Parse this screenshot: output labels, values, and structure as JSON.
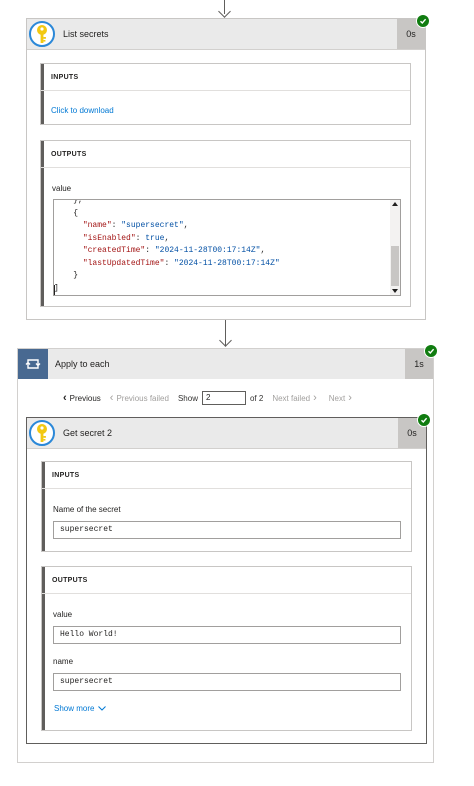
{
  "list_secrets": {
    "title": "List secrets",
    "duration": "0s",
    "inputs": {
      "heading": "INPUTS",
      "download_link": "Click to download"
    },
    "outputs": {
      "heading": "OUTPUTS",
      "value_label": "value",
      "json_lines": [
        {
          "indent": "    ",
          "parts": [
            {
              "t": "p",
              "v": "},"
            }
          ]
        },
        {
          "indent": "    ",
          "parts": [
            {
              "t": "p",
              "v": "{"
            }
          ]
        },
        {
          "indent": "      ",
          "parts": [
            {
              "t": "k",
              "v": "\"name\""
            },
            {
              "t": "p",
              "v": ": "
            },
            {
              "t": "s",
              "v": "\"supersecret\""
            },
            {
              "t": "p",
              "v": ","
            }
          ]
        },
        {
          "indent": "      ",
          "parts": [
            {
              "t": "k",
              "v": "\"isEnabled\""
            },
            {
              "t": "p",
              "v": ": "
            },
            {
              "t": "s",
              "v": "true"
            },
            {
              "t": "p",
              "v": ","
            }
          ]
        },
        {
          "indent": "      ",
          "parts": [
            {
              "t": "k",
              "v": "\"createdTime\""
            },
            {
              "t": "p",
              "v": ": "
            },
            {
              "t": "s",
              "v": "\"2024-11-28T00:17:14Z\""
            },
            {
              "t": "p",
              "v": ","
            }
          ]
        },
        {
          "indent": "      ",
          "parts": [
            {
              "t": "k",
              "v": "\"lastUpdatedTime\""
            },
            {
              "t": "p",
              "v": ": "
            },
            {
              "t": "s",
              "v": "\"2024-11-28T00:17:14Z\""
            }
          ]
        },
        {
          "indent": "    ",
          "parts": [
            {
              "t": "p",
              "v": "}"
            }
          ]
        },
        {
          "indent": "",
          "parts": [
            {
              "t": "p",
              "v": "]"
            }
          ]
        }
      ]
    }
  },
  "apply_to_each": {
    "title": "Apply to each",
    "duration": "1s",
    "pager": {
      "previous": "Previous",
      "previous_failed": "Previous failed",
      "show_label": "Show",
      "current_value": "2",
      "of_label": "of 2",
      "next_failed": "Next failed",
      "next": "Next"
    }
  },
  "get_secret": {
    "title": "Get secret 2",
    "duration": "0s",
    "inputs": {
      "heading": "INPUTS",
      "name_label": "Name of the secret",
      "name_value": "supersecret"
    },
    "outputs": {
      "heading": "OUTPUTS",
      "value_label": "value",
      "value_value": "Hello World!",
      "name_label": "name",
      "name_value": "supersecret",
      "show_more": "Show more"
    }
  },
  "colors": {
    "accent": "#0078d4",
    "success": "#107c10",
    "loop": "#486991",
    "header_bg": "#eaeaea"
  }
}
